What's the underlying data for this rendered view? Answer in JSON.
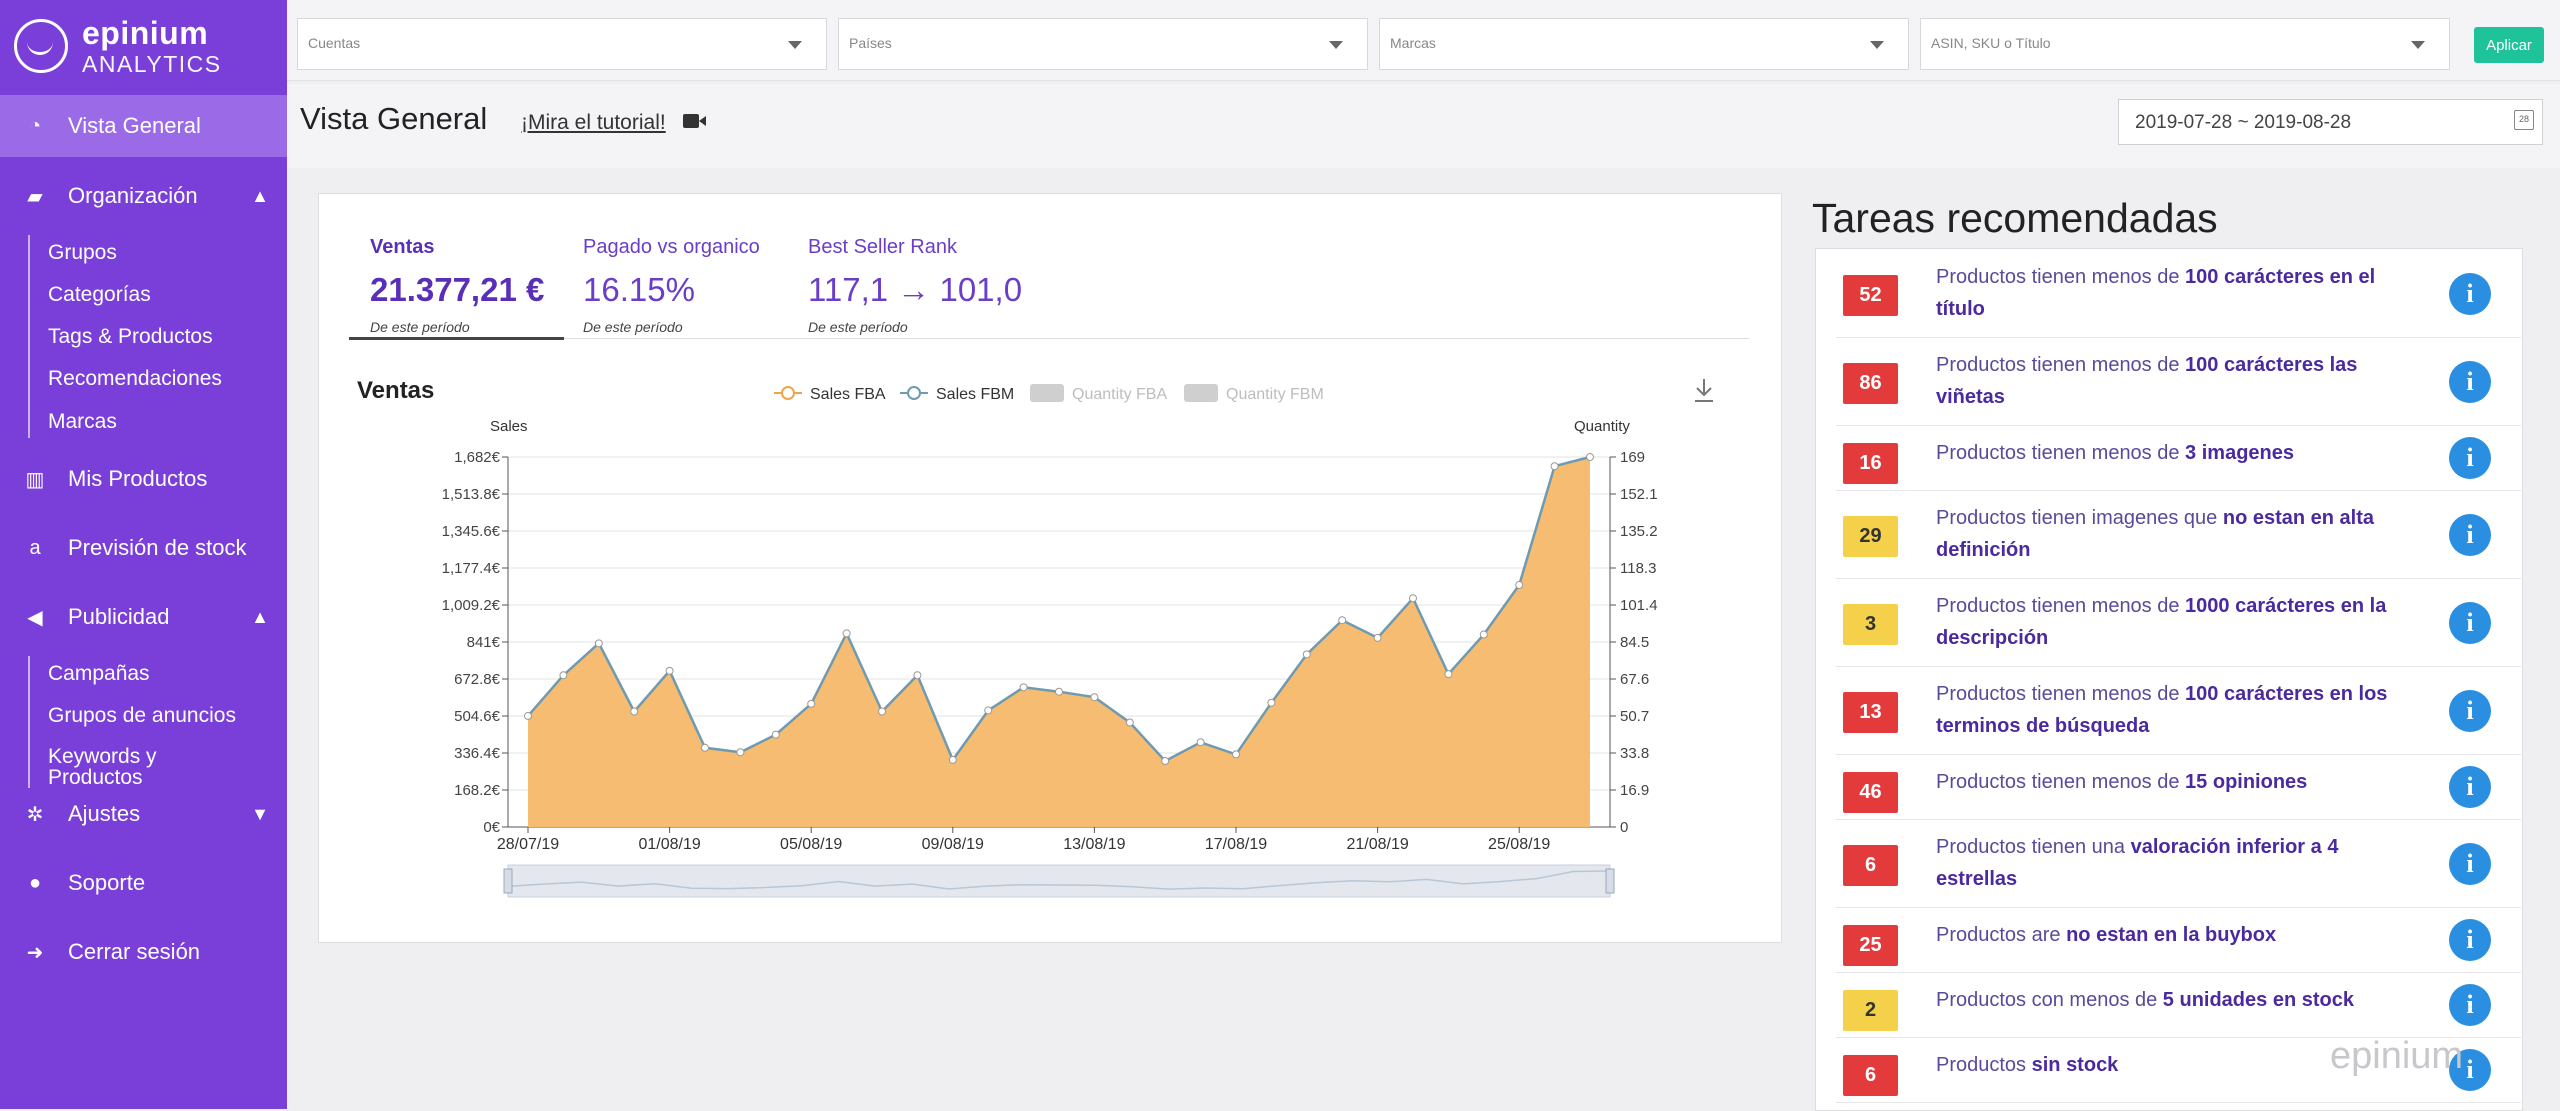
{
  "sidebar": {
    "logo_name": "epinium",
    "logo_sub": "ANALYTICS",
    "items": [
      {
        "label": "Vista General",
        "icon": "dashboard-icon",
        "active": true
      },
      {
        "label": "Organización",
        "icon": "folder-icon",
        "expanded": true,
        "children": [
          "Grupos",
          "Categorías",
          "Tags & Productos",
          "Recomendaciones",
          "Marcas"
        ]
      },
      {
        "label": "Mis Productos",
        "icon": "barcode-icon"
      },
      {
        "label": "Previsión de stock",
        "icon": "amazon-icon"
      },
      {
        "label": "Publicidad",
        "icon": "megaphone-icon",
        "expanded": true,
        "children": [
          "Campañas",
          "Grupos de anuncios",
          "Keywords y",
          "Productos"
        ]
      },
      {
        "label": "Ajustes",
        "icon": "gear-icon"
      },
      {
        "label": "Soporte",
        "icon": "chat-icon"
      },
      {
        "label": "Cerrar sesión",
        "icon": "logout-icon"
      }
    ]
  },
  "filters": {
    "cuentas": "Cuentas",
    "paises": "Países",
    "marcas": "Marcas",
    "asin": "ASIN, SKU o Título",
    "apply": "Aplicar"
  },
  "header": {
    "title": "Vista General",
    "tutorial": "¡Mira el tutorial!",
    "date_range": "2019-07-28 ~ 2019-08-28"
  },
  "kpis": [
    {
      "label": "Ventas",
      "value": "21.377,21 €",
      "period": "De este período"
    },
    {
      "label": "Pagado vs organico",
      "value": "16.15%",
      "period": "De este período"
    },
    {
      "label": "Best Seller Rank",
      "value": "117,1 → 101,0",
      "period": "De este período"
    }
  ],
  "chart_title": "Ventas",
  "chart_data": {
    "type": "area",
    "title": "Ventas",
    "ylabel": "Sales",
    "y2label": "Quantity",
    "legend": [
      "Sales FBA",
      "Sales FBM",
      "Quantity FBA",
      "Quantity FBM"
    ],
    "legend_placement": "top-center",
    "x_tick_labels": [
      "28/07/19",
      "01/08/19",
      "05/08/19",
      "09/08/19",
      "13/08/19",
      "17/08/19",
      "21/08/19",
      "25/08/19"
    ],
    "y_tick_labels": [
      "1,682€",
      "1,513.8€",
      "1,345.6€",
      "1,177.4€",
      "1,009.2€",
      "841€",
      "672.8€",
      "504.6€",
      "336.4€",
      "168.2€",
      "0€"
    ],
    "y2_tick_labels": [
      "169",
      "152.1",
      "135.2",
      "118.3",
      "101.4",
      "84.5",
      "67.6",
      "50.7",
      "33.8",
      "16.9",
      "0"
    ],
    "ylim": [
      0,
      1682
    ],
    "y2lim": [
      0,
      169
    ],
    "x": [
      "28/07/19",
      "29/07/19",
      "30/07/19",
      "31/07/19",
      "01/08/19",
      "02/08/19",
      "03/08/19",
      "04/08/19",
      "05/08/19",
      "06/08/19",
      "07/08/19",
      "08/08/19",
      "09/08/19",
      "10/08/19",
      "11/08/19",
      "12/08/19",
      "13/08/19",
      "14/08/19",
      "15/08/19",
      "16/08/19",
      "17/08/19",
      "18/08/19",
      "19/08/19",
      "20/08/19",
      "21/08/19",
      "22/08/19",
      "23/08/19",
      "24/08/19",
      "25/08/19",
      "26/08/19",
      "27/08/19",
      "28/08/19"
    ],
    "series": [
      {
        "name": "Sales FBA",
        "values": [
          505,
          690,
          835,
          525,
          710,
          360,
          340,
          420,
          560,
          880,
          525,
          690,
          305,
          530,
          635,
          615,
          590,
          475,
          300,
          385,
          330,
          565,
          785,
          940,
          860,
          1040,
          695,
          875,
          1100,
          1640,
          1682
        ]
      },
      {
        "name": "Sales FBM",
        "values": [
          505,
          690,
          835,
          525,
          710,
          360,
          340,
          420,
          560,
          880,
          525,
          690,
          305,
          530,
          635,
          615,
          590,
          475,
          300,
          385,
          330,
          565,
          785,
          940,
          860,
          1040,
          695,
          875,
          1100,
          1640,
          1682
        ]
      }
    ],
    "colors": {
      "fill": "#f5b96a",
      "line": "#6f9ab0",
      "point": "#ffffff"
    }
  },
  "tasks_title": "Tareas recomendadas",
  "tasks": [
    {
      "count": "52",
      "color": "red",
      "pre": "Productos tienen menos de ",
      "bold": "100 carácteres en el título",
      "lines": 2
    },
    {
      "count": "86",
      "color": "red",
      "pre": "Productos tienen menos de ",
      "bold": "100 carácteres las viñetas",
      "lines": 2
    },
    {
      "count": "16",
      "color": "red",
      "pre": "Productos tienen menos de ",
      "bold": "3 imagenes",
      "lines": 1
    },
    {
      "count": "29",
      "color": "yellow",
      "pre": "Productos tienen imagenes que ",
      "bold": "no estan en alta definición",
      "lines": 2
    },
    {
      "count": "3",
      "color": "yellow",
      "pre": "Productos tienen menos de ",
      "bold": "1000 carácteres en la descripción",
      "lines": 2
    },
    {
      "count": "13",
      "color": "red",
      "pre": "Productos tienen menos de ",
      "bold": "100 carácteres en los terminos de búsqueda",
      "lines": 2
    },
    {
      "count": "46",
      "color": "red",
      "pre": "Productos tienen menos de ",
      "bold": "15 opiniones",
      "lines": 1
    },
    {
      "count": "6",
      "color": "red",
      "pre": "Productos tienen una ",
      "bold": "valoración inferior a 4 estrellas",
      "lines": 2
    },
    {
      "count": "25",
      "color": "red",
      "pre": "Productos are ",
      "bold": "no estan en la buybox",
      "lines": 1
    },
    {
      "count": "2",
      "color": "yellow",
      "pre": "Productos con menos de ",
      "bold": "5 unidades en stock",
      "lines": 1
    },
    {
      "count": "6",
      "color": "red",
      "pre": "Productos ",
      "bold": "sin stock",
      "lines": 1
    }
  ],
  "watermark": "epinium"
}
